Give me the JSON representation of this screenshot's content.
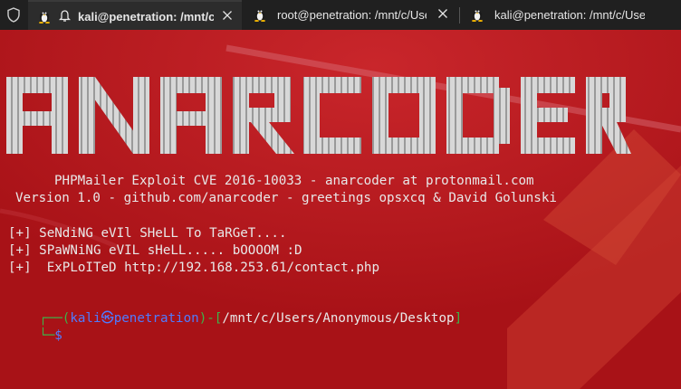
{
  "tabs": [
    {
      "title": "kali@penetration: /mnt/c/U",
      "active": true
    },
    {
      "title": "root@penetration: /mnt/c/User",
      "active": false
    },
    {
      "title": "kali@penetration: /mnt/c/Users",
      "active": false
    }
  ],
  "banner": {
    "logo_text": "ANARCODER"
  },
  "terminal": {
    "info1": "PHPMailer Exploit CVE 2016-10033 - anarcoder at protonmail.com",
    "info2": "Version 1.0 - github.com/anarcoder - greetings opsxcq & David Golunski",
    "status": [
      "[+] SeNdiNG eVIl SHeLL To TaRGeT....",
      "[+] SPaWNiNG eVIL sHeLL..... bOOOOM :D",
      "[+]  ExPLoITeD http://192.168.253.61/contact.php"
    ],
    "prompt_user": "kali",
    "prompt_host": "penetration",
    "prompt_path": "/mnt/c/Users/Anonymous/Desktop",
    "prompt_symbol": "$"
  },
  "colors": {
    "background": "#b8151a",
    "tabbar": "#202020",
    "prompt_green": "#3bb54a",
    "prompt_blue": "#4f7bff"
  }
}
